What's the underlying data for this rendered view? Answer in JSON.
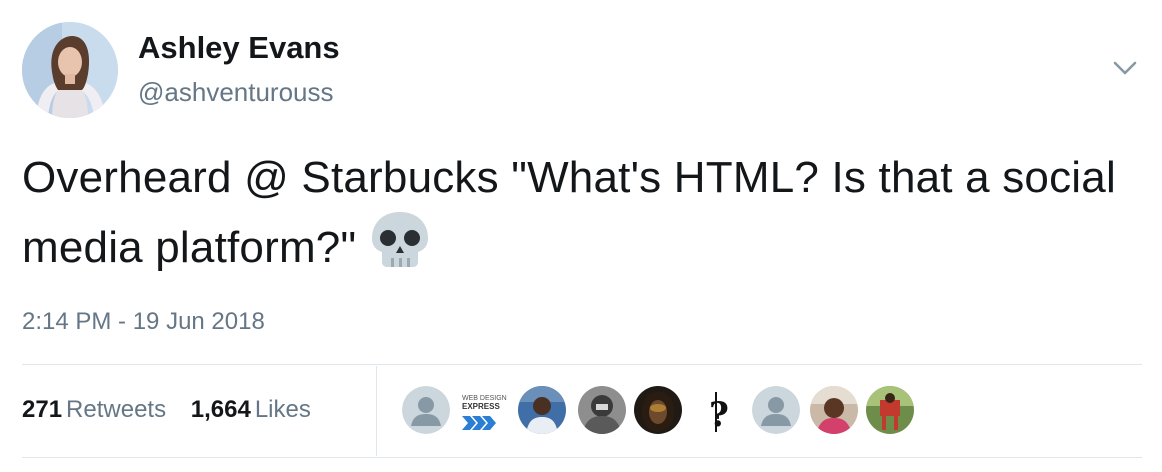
{
  "author": {
    "name": "Ashley Evans",
    "handle": "@ashventurouss"
  },
  "tweet": {
    "text": "Overheard @ Starbucks \"What's HTML? Is that a social media platform?\"",
    "emoji": "skull-emoji",
    "timestamp": "2:14 PM - 19 Jun 2018"
  },
  "stats": {
    "retweets_count": "271",
    "retweets_label": "Retweets",
    "likes_count": "1,664",
    "likes_label": "Likes"
  },
  "likers": [
    {
      "icon": "default-avatar-icon"
    },
    {
      "icon": "web-design-express-logo",
      "line1": "WEB DESIGN",
      "line2": "EXPRESS"
    },
    {
      "icon": "user-avatar-photo"
    },
    {
      "icon": "user-avatar-photo"
    },
    {
      "icon": "user-avatar-photo"
    },
    {
      "icon": "dollar-question-mark-icon"
    },
    {
      "icon": "default-avatar-icon"
    },
    {
      "icon": "user-avatar-photo"
    },
    {
      "icon": "user-avatar-photo"
    }
  ],
  "colors": {
    "primary_text": "#14171a",
    "secondary_text": "#657786",
    "divider": "#e1e8ed",
    "default_avatar_bg": "#ccd6dd",
    "default_avatar_fg": "#8899a6"
  }
}
